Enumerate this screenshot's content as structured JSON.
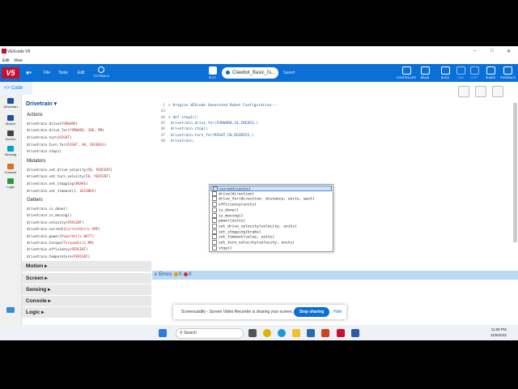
{
  "window": {
    "title": "VEXcode V5",
    "controls": [
      "–",
      "□",
      "✕"
    ]
  },
  "menubar": {
    "items": [
      "Edit",
      "View"
    ]
  },
  "appbar": {
    "logo": "V5",
    "menus": [
      "File",
      "Tools",
      "Edit"
    ],
    "tutorials": "TUTORIALS",
    "slot": "SLOT",
    "project_name": "Clawbot_Basic_fu...",
    "status": "Saved",
    "right_buttons": [
      "CONTROLLER",
      "BRAIN",
      "BUILD",
      "RUN",
      "STOP",
      "SHARE",
      "FEEDBACK"
    ]
  },
  "code_tab": {
    "label": "Code"
  },
  "left_categories": [
    {
      "label": "Drivetrain",
      "color": "#1f4fa0"
    },
    {
      "label": "Motion",
      "color": "#1f4fa0"
    },
    {
      "label": "Screen",
      "color": "#444444"
    },
    {
      "label": "Sensing",
      "color": "#00a0d0"
    },
    {
      "label": "Console",
      "color": "#e07020"
    },
    {
      "label": "Logic",
      "color": "#2a9a3a"
    }
  ],
  "palette": {
    "header": "Drivetrain",
    "sections": [
      {
        "title": "Actions",
        "lines": [
          [
            "drivetrain.drive(",
            "FORWARD",
            ")"
          ],
          [
            "drivetrain.drive_for(",
            "FORWARD, 200, MM",
            ")"
          ],
          [
            "drivetrain.turn(",
            "RIGHT",
            ")"
          ],
          [
            "drivetrain.turn_for(",
            "RIGHT, 90, DEGREES",
            ")"
          ],
          [
            "drivetrain.stop()",
            "",
            ""
          ]
        ]
      },
      {
        "title": "Mutators",
        "lines": [
          [
            "drivetrain.set_drive_velocity(",
            "50, PERCENT",
            ")"
          ],
          [
            "drivetrain.set_turn_velocity(",
            "50, PERCENT",
            ")"
          ],
          [
            "drivetrain.set_stopping(",
            "BRAKE",
            ")"
          ],
          [
            "drivetrain.set_timeout(",
            "1, SECONDS",
            ")"
          ]
        ]
      },
      {
        "title": "Getters",
        "lines": [
          [
            "drivetrain.is_done()",
            "",
            ""
          ],
          [
            "drivetrain.is_moving()",
            "",
            ""
          ],
          [
            "drivetrain.velocity(",
            "PERCENT",
            ")"
          ],
          [
            "drivetrain.current(",
            "CurrentUnits.AMP",
            ")"
          ],
          [
            "drivetrain.power(",
            "PowerUnits.WATT",
            ")"
          ],
          [
            "drivetrain.torque(",
            "TorqueUnits.NM",
            ")"
          ],
          [
            "drivetrain.efficiency(",
            "PERCENT",
            ")"
          ],
          [
            "drivetrain.temperature(",
            "PERCENT",
            ")"
          ]
        ]
      }
    ],
    "categories": [
      "Motion",
      "Screen",
      "Sensing",
      "Console",
      "Logic"
    ]
  },
  "editor": {
    "lines": [
      {
        "num": "1",
        "text": "> #region VEXcode Generated Robot Configuration",
        "extra": "···"
      },
      {
        "num": "43",
        "text": "",
        "extra": ""
      },
      {
        "num": "44",
        "text": "∨ def step1():",
        "extra": ""
      },
      {
        "num": "45",
        "text": "      drivetrain.drive_for(FORWARD,24,INCHES,)",
        "extra": ""
      },
      {
        "num": "46",
        "text": "      drivetrain.stop()",
        "extra": ""
      },
      {
        "num": "47",
        "text": "      drivetrain.turn_for(RIGHT,50,DEGREES,)",
        "extra": ""
      },
      {
        "num": "48",
        "text": "      drivetrain.",
        "extra": ""
      }
    ],
    "autocomplete": [
      "current(units)",
      "drive(direction)",
      "drive_for(direction, distance, units, wait)",
      "efficiency(units)",
      "is_done()",
      "is_moving()",
      "power(units)",
      "set_drive_velocity(velocity, units)",
      "set_stopping(brake)",
      "set_timeout(value, units)",
      "set_turn_velocity(velocity, units)",
      "stop()"
    ],
    "selected_index": 0
  },
  "errors_bar": {
    "label": "Errors",
    "warnings": "0",
    "errors": "0"
  },
  "notification": {
    "text": "Screencastify - Screen Video Recorder is sharing your screen.",
    "stop": "Stop sharing",
    "hide": "Hide"
  },
  "taskbar": {
    "search": "Search",
    "time": "11:08 PM",
    "date": "11/5/2023"
  }
}
